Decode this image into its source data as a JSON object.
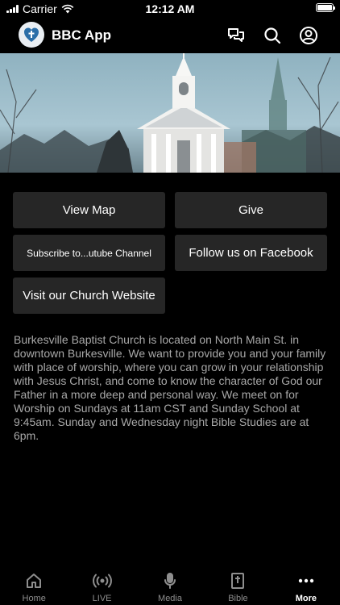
{
  "status_bar": {
    "carrier": "Carrier",
    "time": "12:12 AM"
  },
  "header": {
    "title": "BBC App",
    "icons": [
      "chat-icon",
      "search-icon",
      "profile-icon"
    ]
  },
  "buttons": {
    "view_map": "View Map",
    "give": "Give",
    "subscribe_youtube": "Subscribe to...utube Channel",
    "follow_facebook": "Follow us on Facebook",
    "church_website": "Visit our Church Website"
  },
  "description": "Burkesville Baptist Church is located on North Main St. in downtown  Burkesville.  We want to provide you and your family with place of worship, where you can grow in your relationship with Jesus Christ, and come to know the character of God our Father in a more deep and personal way.  We meet on for Worship on Sundays at 11am CST and Sunday School at 9:45am.  Sunday and Wednesday night Bible Studies are at 6pm.",
  "tab_bar": {
    "tabs": [
      {
        "label": "Home",
        "icon": "home-icon",
        "active": false
      },
      {
        "label": "LIVE",
        "icon": "live-icon",
        "active": false
      },
      {
        "label": "Media",
        "icon": "microphone-icon",
        "active": false
      },
      {
        "label": "Bible",
        "icon": "bible-icon",
        "active": false
      },
      {
        "label": "More",
        "icon": "more-icon",
        "active": true
      }
    ]
  },
  "colors": {
    "background": "#000000",
    "button_bg": "#262626",
    "description_text": "#a8a8a8",
    "inactive_tab": "#8e8e8e"
  }
}
